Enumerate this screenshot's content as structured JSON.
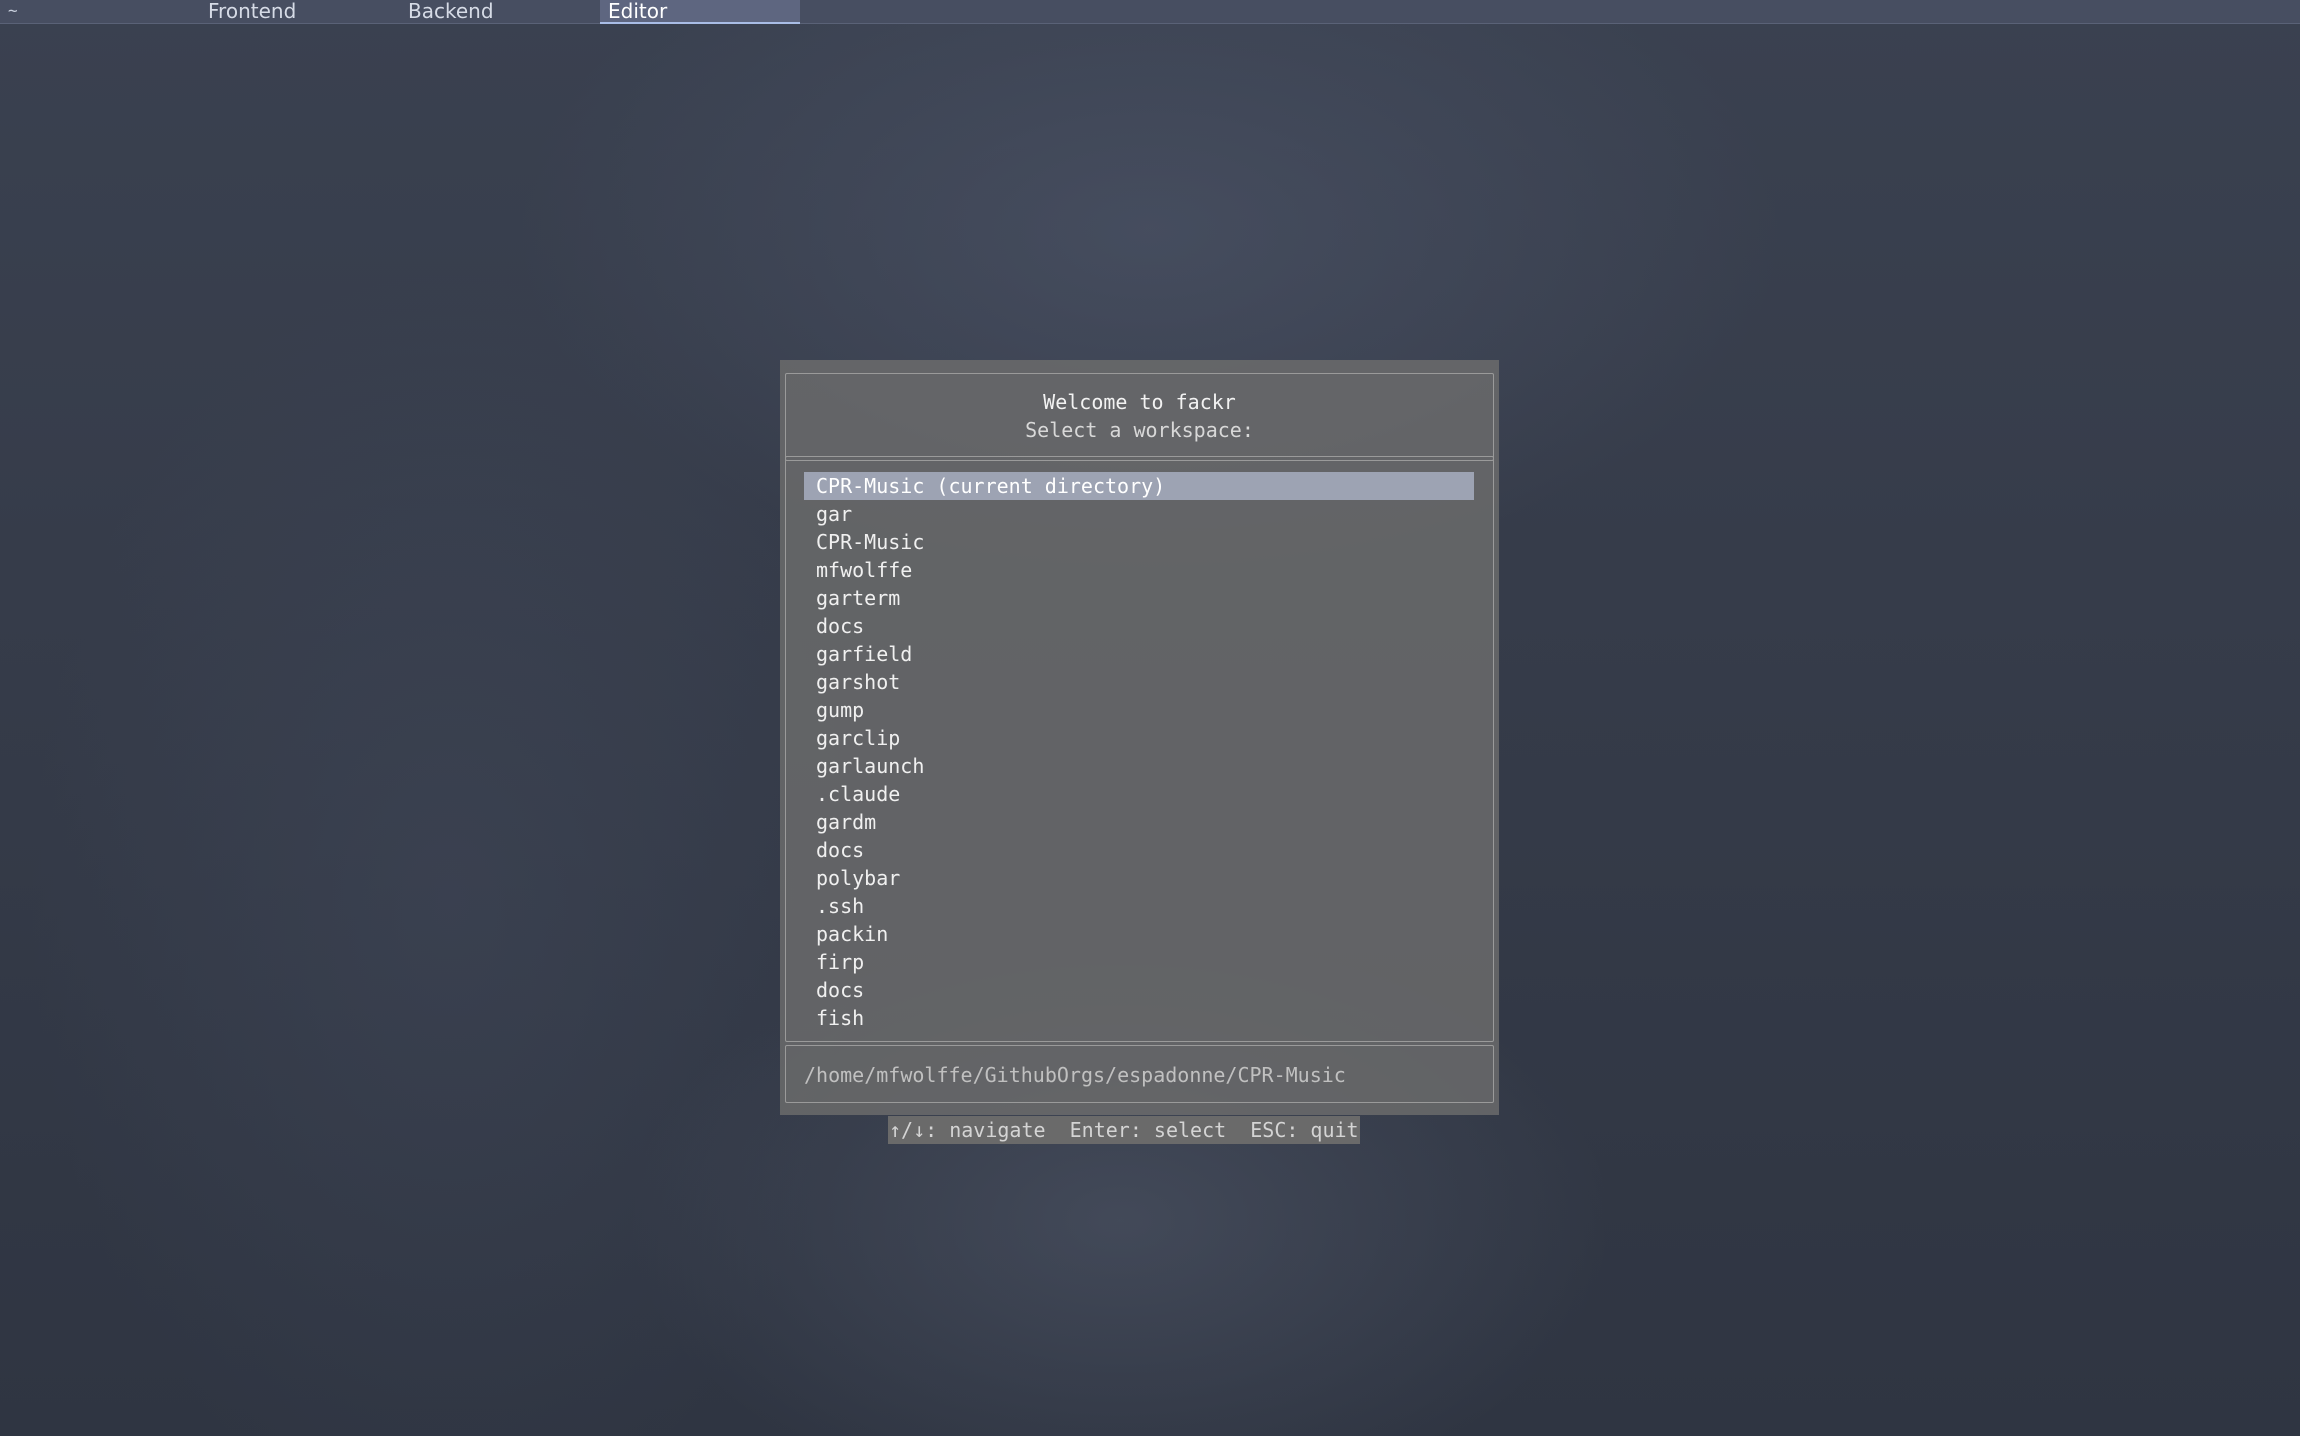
{
  "tabbar": {
    "home_glyph": "~",
    "tabs": [
      {
        "label": "Frontend"
      },
      {
        "label": "Backend"
      },
      {
        "label": "Editor",
        "active": true
      }
    ],
    "accent_color": "#a9bde6"
  },
  "dialog": {
    "title": "Welcome to fackr",
    "subtitle": "Select a workspace:",
    "items": [
      {
        "label": "CPR-Music (current directory)",
        "selected": true
      },
      {
        "label": "gar"
      },
      {
        "label": "CPR-Music"
      },
      {
        "label": "mfwolffe"
      },
      {
        "label": "garterm"
      },
      {
        "label": "docs"
      },
      {
        "label": "garfield"
      },
      {
        "label": "garshot"
      },
      {
        "label": "gump"
      },
      {
        "label": "garclip"
      },
      {
        "label": "garlaunch"
      },
      {
        "label": ".claude"
      },
      {
        "label": "gardm"
      },
      {
        "label": "docs"
      },
      {
        "label": "polybar"
      },
      {
        "label": ".ssh"
      },
      {
        "label": "packin"
      },
      {
        "label": "firp"
      },
      {
        "label": "docs"
      },
      {
        "label": "fish"
      }
    ],
    "path": "/home/mfwolffe/GithubOrgs/espadonne/CPR-Music",
    "selection_color": "#9da3b3"
  },
  "hints": {
    "text": "↑/↓: navigate  Enter: select  ESC: quit"
  }
}
